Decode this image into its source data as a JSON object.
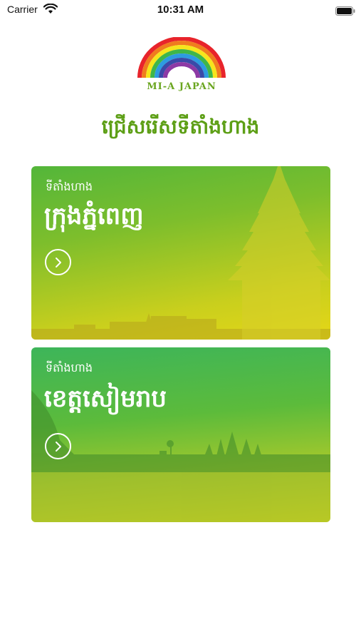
{
  "status_bar": {
    "carrier": "Carrier",
    "time": "10:31 AM"
  },
  "logo": {
    "text": "MI-A JAPAN",
    "colors": [
      "#e8242b",
      "#f07c1e",
      "#f6e51c",
      "#3fb649",
      "#2d9be0",
      "#3a4aa8",
      "#8d3aa5"
    ]
  },
  "page": {
    "title": "ជ្រើសរើសទីតាំងហាង"
  },
  "locations": [
    {
      "label": "ទីតាំងហាង",
      "name": "ក្រុងភ្នំពេញ",
      "icon": "chevron-right-icon"
    },
    {
      "label": "ទីតាំងហាង",
      "name": "ខេត្តសៀមរាប",
      "icon": "chevron-right-icon"
    }
  ],
  "colors": {
    "title_green": "#5d9f16",
    "logo_green": "#6aa51f"
  }
}
